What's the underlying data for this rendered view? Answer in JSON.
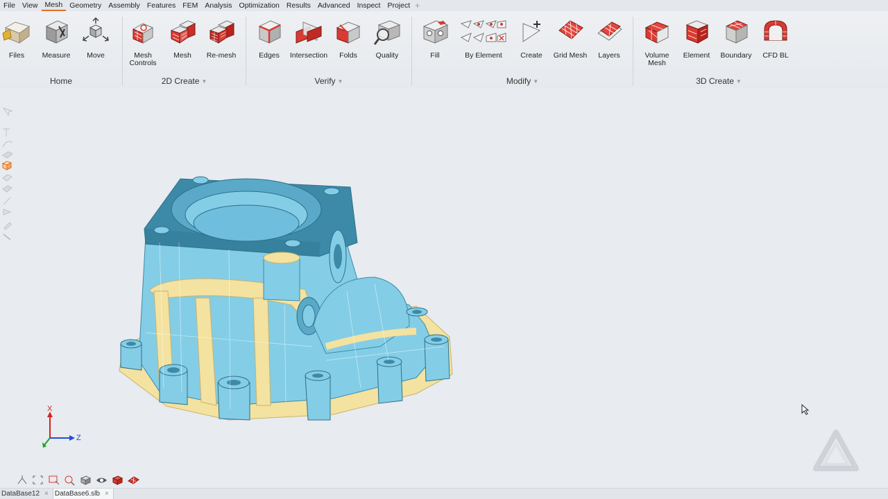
{
  "menu": {
    "items": [
      "File",
      "View",
      "Mesh",
      "Geometry",
      "Assembly",
      "Features",
      "FEM",
      "Analysis",
      "Optimization",
      "Results",
      "Advanced",
      "Inspect",
      "Project"
    ],
    "active": "Mesh",
    "add_symbol": "+"
  },
  "ribbon": {
    "groups": {
      "home": {
        "label": "Home"
      },
      "create2d": {
        "label": "2D Create",
        "caret": "▼"
      },
      "verify": {
        "label": "Verify",
        "caret": "▼"
      },
      "modify": {
        "label": "Modify",
        "caret": "▼"
      },
      "create3d": {
        "label": "3D Create",
        "caret": "▼"
      }
    },
    "tools": {
      "files": "Files",
      "measure": "Measure",
      "move": "Move",
      "mesh_controls": "Mesh\nControls",
      "mesh": "Mesh",
      "remesh": "Re-mesh",
      "edges": "Edges",
      "intersection": "Intersection",
      "folds": "Folds",
      "quality": "Quality",
      "fill": "Fill",
      "by_element": "By Element",
      "create": "Create",
      "grid_mesh": "Grid Mesh",
      "layers": "Layers",
      "volume_mesh": "Volume\nMesh",
      "element": "Element",
      "boundary": "Boundary",
      "cfd_bl": "CFD BL"
    }
  },
  "triad": {
    "x_label": "X",
    "z_label": "Z"
  },
  "tabs": [
    {
      "label": "DataBase12",
      "close": "×"
    },
    {
      "label": "DataBase6.slb",
      "close": "×",
      "active": true
    }
  ],
  "colors": {
    "accent": "#e07020",
    "model_blue": "#84cde6",
    "model_dark": "#3d8aa8",
    "model_yellow": "#f3e2a0",
    "tool_red": "#d93a32"
  }
}
